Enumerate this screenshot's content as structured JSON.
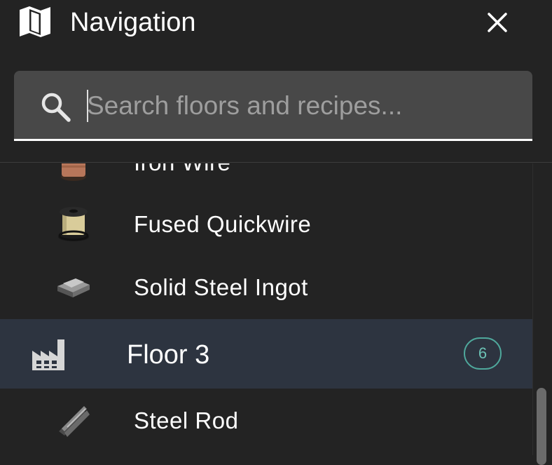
{
  "header": {
    "title": "Navigation",
    "map_icon": "map-icon",
    "close_icon": "close-icon"
  },
  "search": {
    "placeholder": "Search floors and recipes...",
    "value": "",
    "icon": "search-icon"
  },
  "list": {
    "items": [
      {
        "label": "Iron Wire",
        "icon": "wire-spool-icon"
      },
      {
        "label": "Fused Quickwire",
        "icon": "quickwire-spool-icon"
      },
      {
        "label": "Solid Steel Ingot",
        "icon": "steel-ingot-icon"
      }
    ],
    "floor": {
      "label": "Floor 3",
      "count": "6",
      "icon": "factory-icon"
    },
    "items_after": [
      {
        "label": "Steel Rod",
        "icon": "steel-rod-icon"
      }
    ]
  },
  "colors": {
    "background": "#232323",
    "search_bg": "#484848",
    "floor_highlight": "#2d3440",
    "badge_accent": "#4fa89c"
  }
}
